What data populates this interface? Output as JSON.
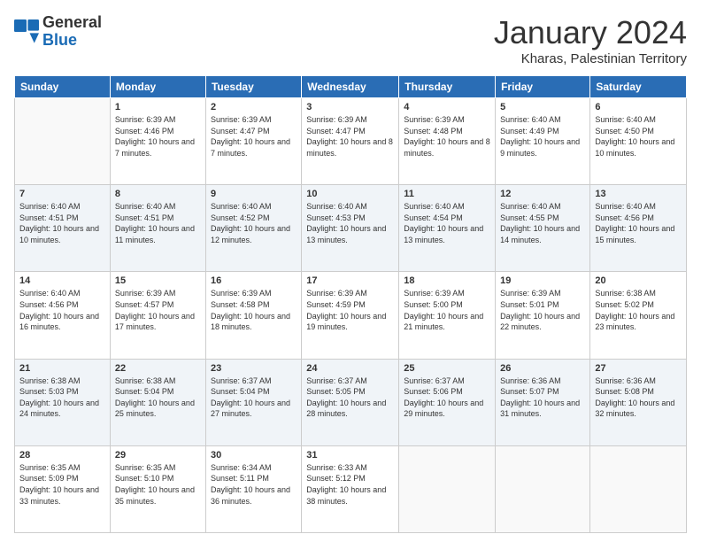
{
  "header": {
    "logo_text_general": "General",
    "logo_text_blue": "Blue",
    "title": "January 2024",
    "subtitle": "Kharas, Palestinian Territory"
  },
  "days_of_week": [
    "Sunday",
    "Monday",
    "Tuesday",
    "Wednesday",
    "Thursday",
    "Friday",
    "Saturday"
  ],
  "weeks": [
    [
      {
        "day": "",
        "sunrise": "",
        "sunset": "",
        "daylight": ""
      },
      {
        "day": "1",
        "sunrise": "Sunrise: 6:39 AM",
        "sunset": "Sunset: 4:46 PM",
        "daylight": "Daylight: 10 hours and 7 minutes."
      },
      {
        "day": "2",
        "sunrise": "Sunrise: 6:39 AM",
        "sunset": "Sunset: 4:47 PM",
        "daylight": "Daylight: 10 hours and 7 minutes."
      },
      {
        "day": "3",
        "sunrise": "Sunrise: 6:39 AM",
        "sunset": "Sunset: 4:47 PM",
        "daylight": "Daylight: 10 hours and 8 minutes."
      },
      {
        "day": "4",
        "sunrise": "Sunrise: 6:39 AM",
        "sunset": "Sunset: 4:48 PM",
        "daylight": "Daylight: 10 hours and 8 minutes."
      },
      {
        "day": "5",
        "sunrise": "Sunrise: 6:40 AM",
        "sunset": "Sunset: 4:49 PM",
        "daylight": "Daylight: 10 hours and 9 minutes."
      },
      {
        "day": "6",
        "sunrise": "Sunrise: 6:40 AM",
        "sunset": "Sunset: 4:50 PM",
        "daylight": "Daylight: 10 hours and 10 minutes."
      }
    ],
    [
      {
        "day": "7",
        "sunrise": "Sunrise: 6:40 AM",
        "sunset": "Sunset: 4:51 PM",
        "daylight": "Daylight: 10 hours and 10 minutes."
      },
      {
        "day": "8",
        "sunrise": "Sunrise: 6:40 AM",
        "sunset": "Sunset: 4:51 PM",
        "daylight": "Daylight: 10 hours and 11 minutes."
      },
      {
        "day": "9",
        "sunrise": "Sunrise: 6:40 AM",
        "sunset": "Sunset: 4:52 PM",
        "daylight": "Daylight: 10 hours and 12 minutes."
      },
      {
        "day": "10",
        "sunrise": "Sunrise: 6:40 AM",
        "sunset": "Sunset: 4:53 PM",
        "daylight": "Daylight: 10 hours and 13 minutes."
      },
      {
        "day": "11",
        "sunrise": "Sunrise: 6:40 AM",
        "sunset": "Sunset: 4:54 PM",
        "daylight": "Daylight: 10 hours and 13 minutes."
      },
      {
        "day": "12",
        "sunrise": "Sunrise: 6:40 AM",
        "sunset": "Sunset: 4:55 PM",
        "daylight": "Daylight: 10 hours and 14 minutes."
      },
      {
        "day": "13",
        "sunrise": "Sunrise: 6:40 AM",
        "sunset": "Sunset: 4:56 PM",
        "daylight": "Daylight: 10 hours and 15 minutes."
      }
    ],
    [
      {
        "day": "14",
        "sunrise": "Sunrise: 6:40 AM",
        "sunset": "Sunset: 4:56 PM",
        "daylight": "Daylight: 10 hours and 16 minutes."
      },
      {
        "day": "15",
        "sunrise": "Sunrise: 6:39 AM",
        "sunset": "Sunset: 4:57 PM",
        "daylight": "Daylight: 10 hours and 17 minutes."
      },
      {
        "day": "16",
        "sunrise": "Sunrise: 6:39 AM",
        "sunset": "Sunset: 4:58 PM",
        "daylight": "Daylight: 10 hours and 18 minutes."
      },
      {
        "day": "17",
        "sunrise": "Sunrise: 6:39 AM",
        "sunset": "Sunset: 4:59 PM",
        "daylight": "Daylight: 10 hours and 19 minutes."
      },
      {
        "day": "18",
        "sunrise": "Sunrise: 6:39 AM",
        "sunset": "Sunset: 5:00 PM",
        "daylight": "Daylight: 10 hours and 21 minutes."
      },
      {
        "day": "19",
        "sunrise": "Sunrise: 6:39 AM",
        "sunset": "Sunset: 5:01 PM",
        "daylight": "Daylight: 10 hours and 22 minutes."
      },
      {
        "day": "20",
        "sunrise": "Sunrise: 6:38 AM",
        "sunset": "Sunset: 5:02 PM",
        "daylight": "Daylight: 10 hours and 23 minutes."
      }
    ],
    [
      {
        "day": "21",
        "sunrise": "Sunrise: 6:38 AM",
        "sunset": "Sunset: 5:03 PM",
        "daylight": "Daylight: 10 hours and 24 minutes."
      },
      {
        "day": "22",
        "sunrise": "Sunrise: 6:38 AM",
        "sunset": "Sunset: 5:04 PM",
        "daylight": "Daylight: 10 hours and 25 minutes."
      },
      {
        "day": "23",
        "sunrise": "Sunrise: 6:37 AM",
        "sunset": "Sunset: 5:04 PM",
        "daylight": "Daylight: 10 hours and 27 minutes."
      },
      {
        "day": "24",
        "sunrise": "Sunrise: 6:37 AM",
        "sunset": "Sunset: 5:05 PM",
        "daylight": "Daylight: 10 hours and 28 minutes."
      },
      {
        "day": "25",
        "sunrise": "Sunrise: 6:37 AM",
        "sunset": "Sunset: 5:06 PM",
        "daylight": "Daylight: 10 hours and 29 minutes."
      },
      {
        "day": "26",
        "sunrise": "Sunrise: 6:36 AM",
        "sunset": "Sunset: 5:07 PM",
        "daylight": "Daylight: 10 hours and 31 minutes."
      },
      {
        "day": "27",
        "sunrise": "Sunrise: 6:36 AM",
        "sunset": "Sunset: 5:08 PM",
        "daylight": "Daylight: 10 hours and 32 minutes."
      }
    ],
    [
      {
        "day": "28",
        "sunrise": "Sunrise: 6:35 AM",
        "sunset": "Sunset: 5:09 PM",
        "daylight": "Daylight: 10 hours and 33 minutes."
      },
      {
        "day": "29",
        "sunrise": "Sunrise: 6:35 AM",
        "sunset": "Sunset: 5:10 PM",
        "daylight": "Daylight: 10 hours and 35 minutes."
      },
      {
        "day": "30",
        "sunrise": "Sunrise: 6:34 AM",
        "sunset": "Sunset: 5:11 PM",
        "daylight": "Daylight: 10 hours and 36 minutes."
      },
      {
        "day": "31",
        "sunrise": "Sunrise: 6:33 AM",
        "sunset": "Sunset: 5:12 PM",
        "daylight": "Daylight: 10 hours and 38 minutes."
      },
      {
        "day": "",
        "sunrise": "",
        "sunset": "",
        "daylight": ""
      },
      {
        "day": "",
        "sunrise": "",
        "sunset": "",
        "daylight": ""
      },
      {
        "day": "",
        "sunrise": "",
        "sunset": "",
        "daylight": ""
      }
    ]
  ]
}
